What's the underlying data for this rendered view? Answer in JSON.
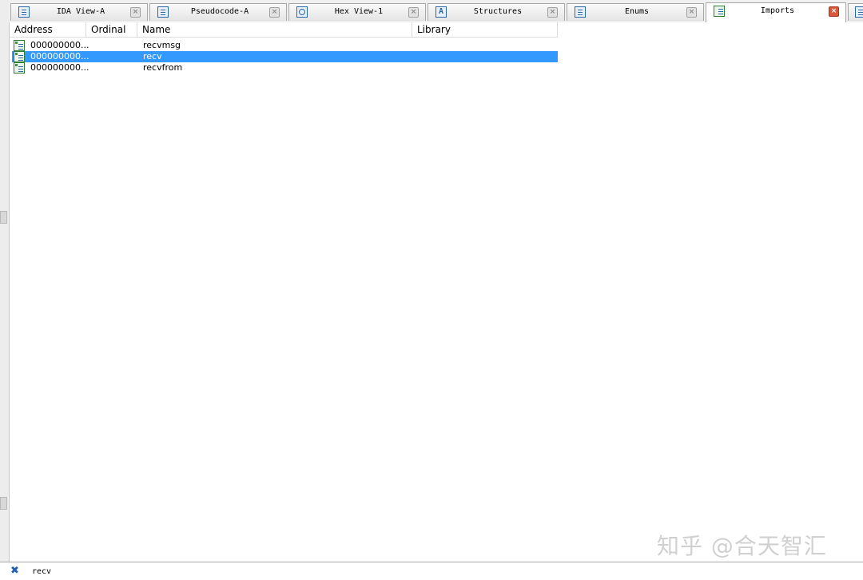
{
  "tabs": [
    {
      "label": "IDA View-A",
      "icon": "ida-view-icon",
      "close": "×"
    },
    {
      "label": "Pseudocode-A",
      "icon": "pseudocode-icon",
      "close": "×"
    },
    {
      "label": "Hex View-1",
      "icon": "hex-view-icon",
      "close": "×"
    },
    {
      "label": "Structures",
      "icon": "structures-icon",
      "icon_glyph": "A",
      "close": "×"
    },
    {
      "label": "Enums",
      "icon": "enums-icon",
      "close": "×"
    },
    {
      "label": "Imports",
      "icon": "imports-icon",
      "close": "×",
      "active": true
    }
  ],
  "list": {
    "columns": [
      "Address",
      "Ordinal",
      "Name",
      "Library"
    ],
    "rows": [
      {
        "address": "000000000...",
        "ordinal": "",
        "name": "recvmsg",
        "library": "",
        "selected": false
      },
      {
        "address": "000000000...",
        "ordinal": "",
        "name": "recv",
        "library": "",
        "selected": true
      },
      {
        "address": "000000000...",
        "ordinal": "",
        "name": "recvfrom",
        "library": "",
        "selected": false
      }
    ]
  },
  "filter": {
    "value": "recv",
    "close_icon": "close-filter-icon"
  },
  "watermark": "知乎 @合天智汇",
  "colors": {
    "selection": "#3399ff",
    "tab_active_close": "#d9573a"
  }
}
